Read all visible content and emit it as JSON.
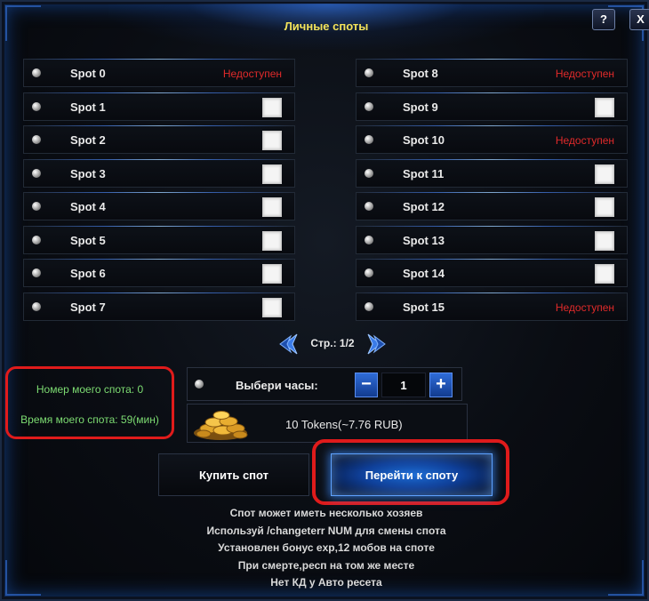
{
  "window": {
    "title": "Личные споты",
    "help_label": "?",
    "close_label": "X"
  },
  "spots_left": [
    {
      "name": "Spot 0",
      "status": "Недоступен"
    },
    {
      "name": "Spot 1",
      "status": ""
    },
    {
      "name": "Spot 2",
      "status": ""
    },
    {
      "name": "Spot 3",
      "status": ""
    },
    {
      "name": "Spot 4",
      "status": ""
    },
    {
      "name": "Spot 5",
      "status": ""
    },
    {
      "name": "Spot 6",
      "status": ""
    },
    {
      "name": "Spot 7",
      "status": ""
    }
  ],
  "spots_right": [
    {
      "name": "Spot 8",
      "status": "Недоступен"
    },
    {
      "name": "Spot 9",
      "status": ""
    },
    {
      "name": "Spot 10",
      "status": "Недоступен"
    },
    {
      "name": "Spot 11",
      "status": ""
    },
    {
      "name": "Spot 12",
      "status": ""
    },
    {
      "name": "Spot 13",
      "status": ""
    },
    {
      "name": "Spot 14",
      "status": ""
    },
    {
      "name": "Spot 15",
      "status": "Недоступен"
    }
  ],
  "pager": {
    "label": "Стр.: 1/2"
  },
  "my_spot": {
    "number_text": "Номер моего спота: 0",
    "time_text": "Время моего спота: 59(мин)"
  },
  "hours": {
    "label": "Выбери часы:",
    "value": "1",
    "minus": "−",
    "plus": "+"
  },
  "price": {
    "label": "10 Tokens(~7.76 RUB)"
  },
  "buttons": {
    "buy": "Купить спот",
    "go": "Перейти к споту"
  },
  "notes": [
    "Спот может иметь несколько хозяев",
    "Используй /changeterr NUM       для смены спота",
    "Установлен бонус exp,12 мобов на споте",
    "При смерте,респ на том же месте",
    "Нет КД у Авто ресета"
  ],
  "colors": {
    "unavailable": "#e02a2a",
    "title": "#f3e35a",
    "info_green": "#7ddc72",
    "highlight_red": "#e01b1b",
    "accent_blue": "#2f6cd8"
  },
  "icons": {
    "orb": "orb-icon",
    "checkbox": "checkbox",
    "coins": "coins-icon",
    "prev": "chevron-left-icon",
    "next": "chevron-right-icon"
  }
}
